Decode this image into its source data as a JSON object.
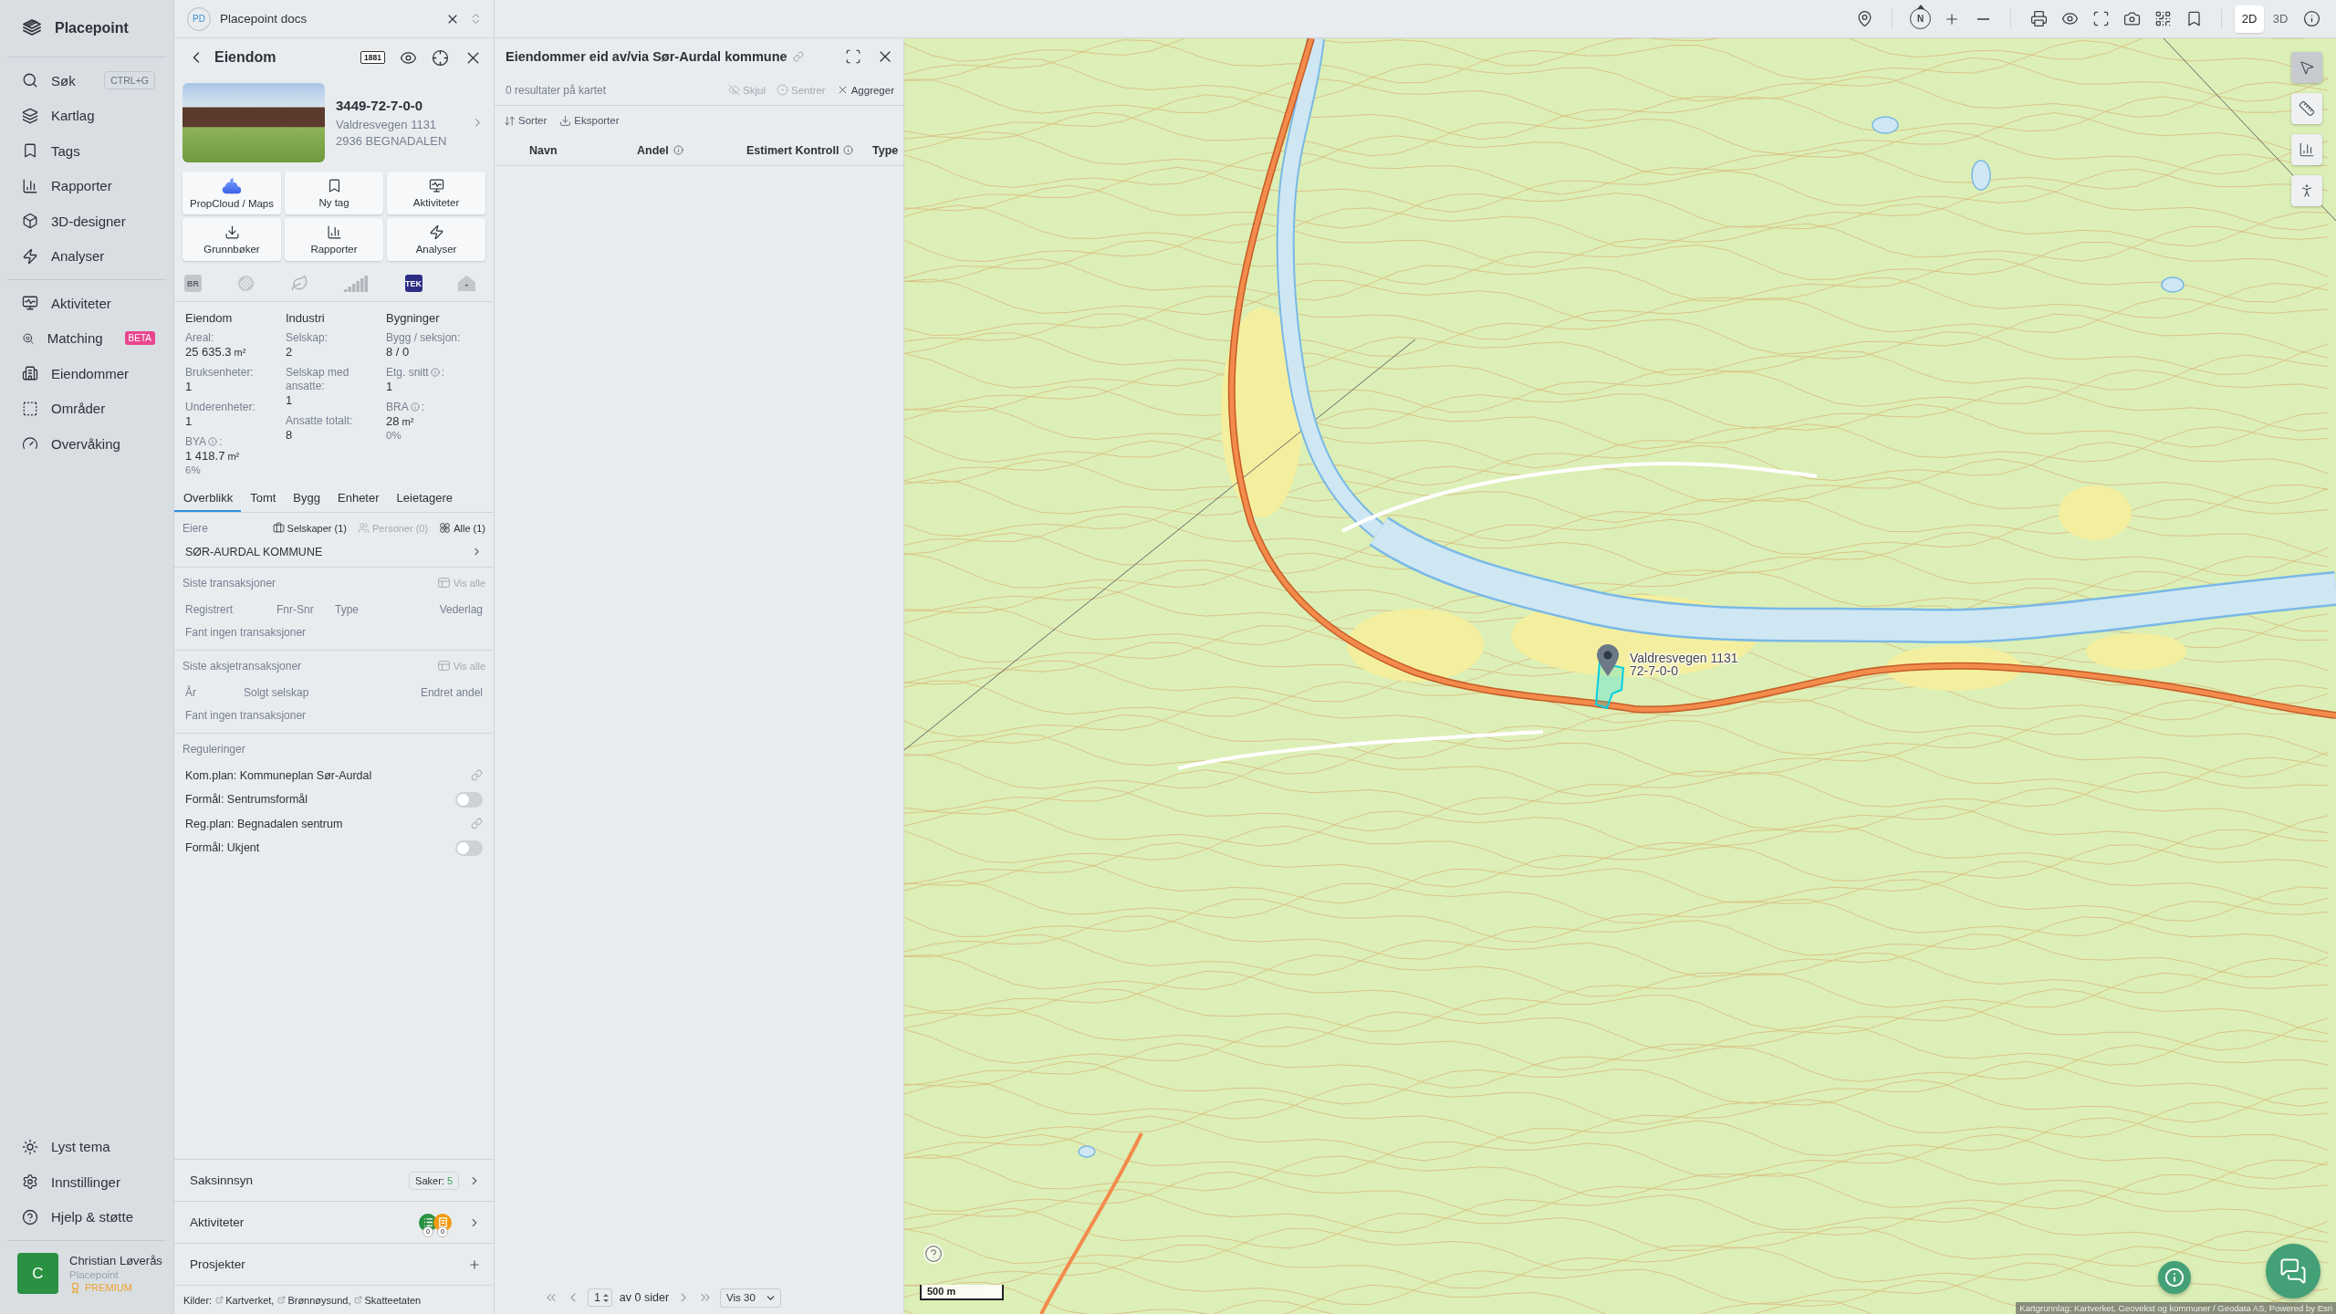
{
  "sidebar": {
    "brand": "Placepoint",
    "nav_top": [
      {
        "label": "Søk",
        "shortcut": "CTRL+G"
      },
      {
        "label": "Kartlag"
      },
      {
        "label": "Tags"
      },
      {
        "label": "Rapporter"
      },
      {
        "label": "3D-designer"
      },
      {
        "label": "Analyser"
      }
    ],
    "nav_middle": [
      {
        "label": "Aktiviteter"
      },
      {
        "label": "Matching",
        "badge": "BETA"
      },
      {
        "label": "Eiendommer"
      },
      {
        "label": "Områder"
      },
      {
        "label": "Overvåking"
      }
    ],
    "nav_bottom": [
      {
        "label": "Lyst tema"
      },
      {
        "label": "Innstillinger"
      },
      {
        "label": "Hjelp & støtte"
      }
    ],
    "user": {
      "initial": "C",
      "name": "Christian Løverås",
      "org": "Placepoint",
      "plan": "PREMIUM"
    }
  },
  "doc_tab": {
    "initials": "PD",
    "title": "Placepoint docs"
  },
  "property_panel": {
    "title": "Eiendom",
    "directory_badge": "1881",
    "property": {
      "id": "3449-72-7-0-0",
      "address": [
        "Valdresvegen 1131",
        "2936 BEGNADALEN"
      ]
    },
    "actions": [
      "PropCloud / Maps",
      "Ny tag",
      "Aktiviteter",
      "Grunnbøker",
      "Rapporter",
      "Analyser"
    ],
    "sources": [
      {
        "kind": "tile",
        "text": "BR",
        "active": false
      },
      {
        "kind": "disc",
        "active": false
      },
      {
        "kind": "leaf",
        "active": false
      },
      {
        "kind": "steps",
        "active": false
      },
      {
        "kind": "tile",
        "text": "TEK",
        "active": true
      },
      {
        "kind": "house",
        "text": "-",
        "active": false
      }
    ],
    "stats": [
      {
        "title": "Eiendom",
        "fields": [
          {
            "label": "Areal:",
            "info": false,
            "value": "25 635.3",
            "unit": "m²"
          },
          {
            "label": "Bruksenheter:",
            "info": false,
            "value": "1"
          },
          {
            "label": "Underenheter:",
            "info": false,
            "value": "1"
          },
          {
            "label": "BYA",
            "info": true,
            "label_end": ":",
            "value": "1 418.7",
            "unit": "m²",
            "note": "6%"
          }
        ]
      },
      {
        "title": "Industri",
        "fields": [
          {
            "label": "Selskap:",
            "info": false,
            "value": "2"
          },
          {
            "label": "Selskap med ansatte:",
            "info": false,
            "value": "1"
          },
          {
            "label": "Ansatte totalt:",
            "info": false,
            "value": "8"
          }
        ]
      },
      {
        "title": "Bygninger",
        "fields": [
          {
            "label": "Bygg / seksjon:",
            "info": false,
            "value": "8 / 0"
          },
          {
            "label": "Etg. snitt",
            "info": true,
            "label_end": ":",
            "value": "1"
          },
          {
            "label": "BRA",
            "info": true,
            "label_end": ":",
            "value": "28",
            "unit": "m²",
            "note": "0%"
          }
        ]
      }
    ],
    "tabs": [
      {
        "label": "Overblikk",
        "selected": true
      },
      {
        "label": "Tomt",
        "selected": false
      },
      {
        "label": "Bygg",
        "selected": false
      },
      {
        "label": "Enheter",
        "selected": false
      },
      {
        "label": "Leietagere",
        "selected": false
      }
    ],
    "owners": {
      "title": "Eiere",
      "filters": [
        {
          "label": "Selskaper (1)",
          "disabled": false
        },
        {
          "label": "Personer (0)",
          "disabled": true
        },
        {
          "label": "Alle (1)",
          "disabled": false
        }
      ],
      "items": [
        "SØR-AURDAL KOMMUNE"
      ]
    },
    "transactions": {
      "title": "Siste transaksjoner",
      "link": "Vis alle",
      "columns": [
        "Registrert",
        "Fnr-Snr",
        "Type",
        "Vederlag"
      ],
      "empty": "Fant ingen transaksjoner"
    },
    "share_transactions": {
      "title": "Siste aksjetransaksjoner",
      "link": "Vis alle",
      "columns": [
        "År",
        "Solgt selskap",
        "Endret andel"
      ],
      "empty": "Fant ingen transaksjoner"
    },
    "regulations": {
      "title": "Reguleringer",
      "items": [
        {
          "kind": "link",
          "text": "Kom.plan: Kommuneplan Sør-Aurdal"
        },
        {
          "kind": "toggle",
          "text": "Formål: Sentrumsformål",
          "on": false
        },
        {
          "kind": "link",
          "text": "Reg.plan: Begnadalen sentrum"
        },
        {
          "kind": "toggle",
          "text": "Formål: Ukjent",
          "on": false
        }
      ]
    },
    "sections": [
      {
        "kind": "count",
        "label": "Saksinnsyn",
        "badge_label": "Saker:",
        "badge_value": "5"
      },
      {
        "kind": "activities",
        "label": "Aktiviteter",
        "counts": [
          "0",
          "0"
        ]
      },
      {
        "kind": "add",
        "label": "Prosjekter"
      }
    ],
    "sources_footer": {
      "label": "Kilder:",
      "links": [
        "Kartverket,",
        "Brønnøysund,",
        "Skatteetaten"
      ]
    }
  },
  "results_panel": {
    "title": "Eiendommer eid av/via Sør-Aurdal kommune",
    "count": "0 resultater på kartet",
    "actions": [
      {
        "label": "Skjul",
        "disabled": true
      },
      {
        "label": "Sentrer",
        "disabled": true
      },
      {
        "label": "Aggreger",
        "disabled": false
      }
    ],
    "tools": [
      "Sorter",
      "Eksporter"
    ],
    "columns": [
      {
        "label": "Navn",
        "info": false
      },
      {
        "label": "Andel",
        "info": true
      },
      {
        "label": "Estimert Kontroll",
        "info": true
      },
      {
        "label": "Type",
        "info": false
      }
    ],
    "pagination": {
      "page": "1",
      "of": "av 0 sider",
      "per_page": "Vis 30"
    }
  },
  "map_toolbar": {
    "compass": "N",
    "view_modes": [
      {
        "label": "2D",
        "selected": true
      },
      {
        "label": "3D",
        "selected": false
      }
    ]
  },
  "map": {
    "side_tools": [
      {
        "selected": true
      },
      {
        "selected": false
      },
      {
        "selected": false
      },
      {
        "selected": false
      }
    ],
    "marker": {
      "lines": [
        "Valdresvegen 1131",
        "72-7-0-0"
      ]
    },
    "scale": "500 m",
    "attribution": "Kartgrunnlag: Kartverket, Geovekst og kommuner / Geodata AS, Powered by Esri"
  }
}
